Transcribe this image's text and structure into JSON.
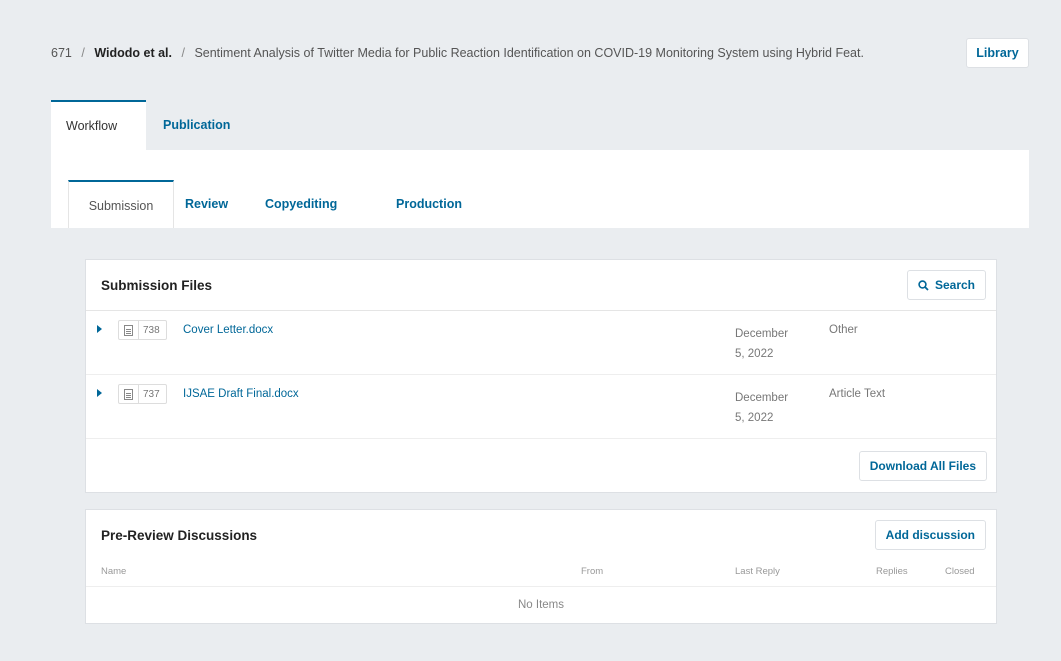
{
  "breadcrumb": {
    "id": "671",
    "separator": "/",
    "authors": "Widodo et al.",
    "title": "Sentiment Analysis of Twitter Media for Public Reaction Identification on COVID-19 Monitoring System using Hybrid Feat."
  },
  "library_button": "Library",
  "outer_tabs": [
    "Workflow",
    "Publication"
  ],
  "inner_tabs": [
    "Submission",
    "Review",
    "Copyediting",
    "Production"
  ],
  "submission_files": {
    "title": "Submission Files",
    "search_label": "Search",
    "files": [
      {
        "id": "738",
        "name": "Cover Letter.docx",
        "date_line1": "December",
        "date_line2": "5, 2022",
        "type": "Other"
      },
      {
        "id": "737",
        "name": "IJSAE Draft Final.docx",
        "date_line1": "December",
        "date_line2": "5, 2022",
        "type": "Article Text"
      }
    ],
    "download_all_label": "Download All Files"
  },
  "pre_review": {
    "title": "Pre-Review Discussions",
    "add_label": "Add discussion",
    "columns": [
      "Name",
      "From",
      "Last Reply",
      "Replies",
      "Closed"
    ],
    "empty_text": "No Items"
  },
  "colors": {
    "accent": "#006798",
    "background": "#eaedf0"
  },
  "icons": [
    "search-icon",
    "document-icon",
    "expand-arrow-icon"
  ]
}
